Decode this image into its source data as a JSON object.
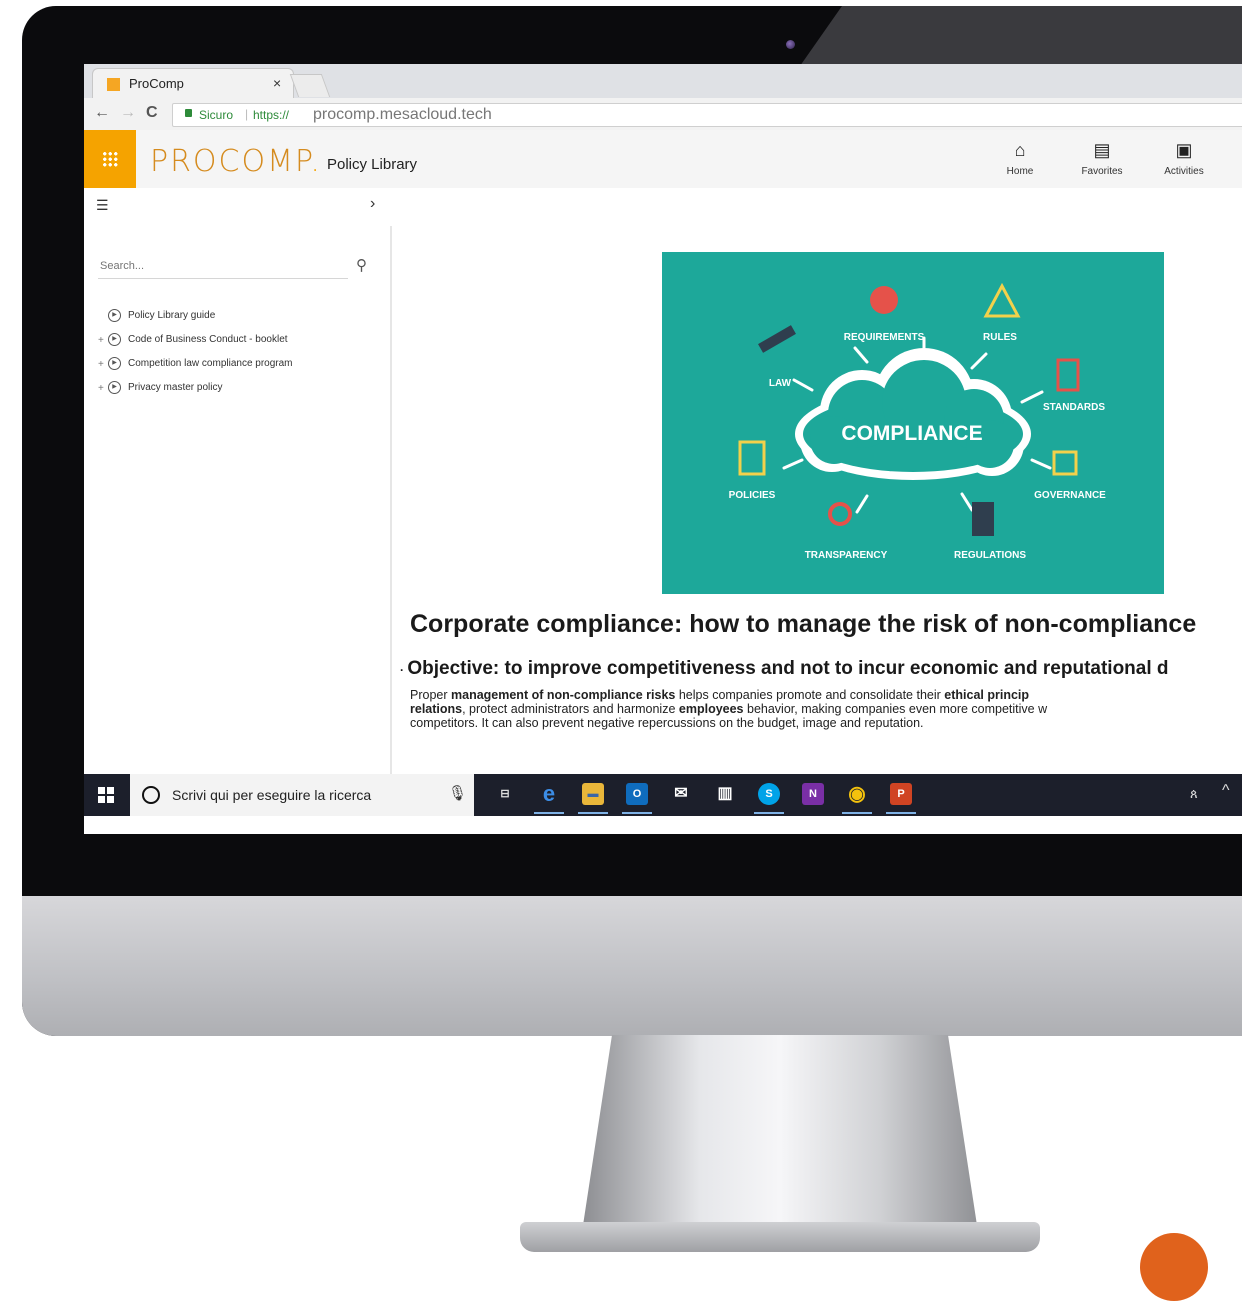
{
  "browser": {
    "tab_title": "ProComp",
    "tab_close": "×",
    "nav_back": "←",
    "nav_forward": "→",
    "nav_reload": "C",
    "secure_label": "Sicuro",
    "url_protocol": "https://",
    "url_host": "procomp.mesacloud.tech"
  },
  "app": {
    "logo_text": "PROCOMP",
    "logo_dot": ".",
    "title": "Policy Library",
    "header_nav": [
      {
        "label": "Home",
        "icon": "home-icon",
        "glyph": "⌂"
      },
      {
        "label": "Favorites",
        "icon": "favorites-icon",
        "glyph": "▤"
      },
      {
        "label": "Activities",
        "icon": "activities-icon",
        "glyph": "▣"
      }
    ],
    "accent_color": "#f5a300"
  },
  "sidebar": {
    "search_placeholder": "Search...",
    "tree": [
      {
        "label": "Policy Library guide",
        "expandable": false
      },
      {
        "label": "Code of Business Conduct - booklet",
        "expandable": true
      },
      {
        "label": "Competition law compliance program",
        "expandable": true
      },
      {
        "label": "Privacy master policy",
        "expandable": true
      }
    ]
  },
  "content": {
    "hero": {
      "center": "COMPLIANCE",
      "labels": [
        "REQUIREMENTS",
        "RULES",
        "LAW",
        "STANDARDS",
        "POLICIES",
        "GOVERNANCE",
        "TRANSPARENCY",
        "REGULATIONS"
      ],
      "background": "#1da89a"
    },
    "title": "Corporate compliance: how to manage the risk of non-compliance",
    "objective": "Objective: to improve competitiveness and not to incur economic and reputational d",
    "body_line1_parts": [
      "Proper ",
      "management of non-compliance risks",
      " helps companies promote and consolidate their ",
      "ethical princip"
    ],
    "body_line2_parts": [
      "relations",
      ", protect administrators and harmonize ",
      "employees",
      " behavior, making companies even more competitive w"
    ],
    "body_line3": "competitors. It can also prevent negative repercussions on the budget, image and reputation."
  },
  "taskbar": {
    "search_text": "Scrivi qui per eseguire la ricerca",
    "apps": [
      {
        "name": "task-view",
        "glyph": "⊟",
        "color": "#1c1f2b"
      },
      {
        "name": "edge",
        "glyph": "e",
        "color": "#1c1f2b"
      },
      {
        "name": "file-explorer",
        "glyph": "▬",
        "color": "#e9b63a"
      },
      {
        "name": "outlook",
        "glyph": "O",
        "color": "#0f6cbd"
      },
      {
        "name": "mail",
        "glyph": "✉",
        "color": "#1c1f2b"
      },
      {
        "name": "store",
        "glyph": "▥",
        "color": "#1c1f2b"
      },
      {
        "name": "skype",
        "glyph": "S",
        "color": "#00a3e8"
      },
      {
        "name": "onenote",
        "glyph": "N",
        "color": "#7a2fa6"
      },
      {
        "name": "chrome",
        "glyph": "◉",
        "color": "#d94735"
      },
      {
        "name": "powerpoint",
        "glyph": "P",
        "color": "#d04423"
      }
    ]
  }
}
